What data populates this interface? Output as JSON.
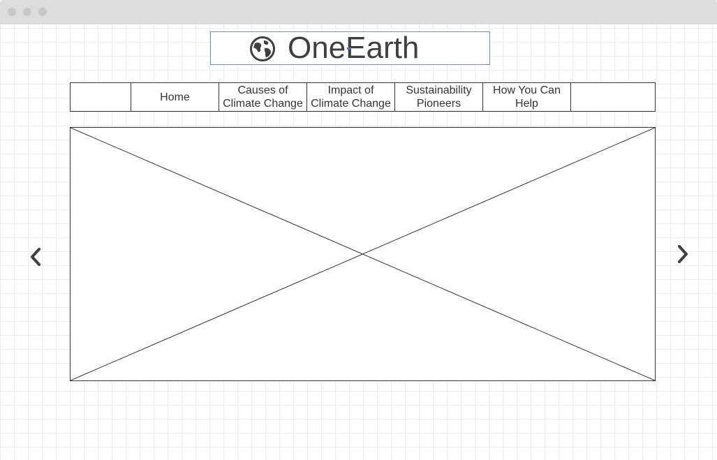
{
  "header": {
    "brand": "OneEarth",
    "logo_icon": "globe-icon"
  },
  "nav": {
    "items": [
      {
        "label": ""
      },
      {
        "label": "Home"
      },
      {
        "label": "Causes of\nClimate Change"
      },
      {
        "label": "Impact of\nClimate Change"
      },
      {
        "label": "Sustainability\nPioneers"
      },
      {
        "label": "How You Can\nHelp"
      },
      {
        "label": ""
      }
    ]
  },
  "carousel": {
    "image_placeholder": "image-placeholder",
    "prev_icon": "chevron-left-icon",
    "next_icon": "chevron-right-icon"
  },
  "colors": {
    "text": "#3f3f3f",
    "border": "#333333",
    "selection": "#6f8fca",
    "grid": "#ededed",
    "titlebar": "#dcdcdc"
  }
}
